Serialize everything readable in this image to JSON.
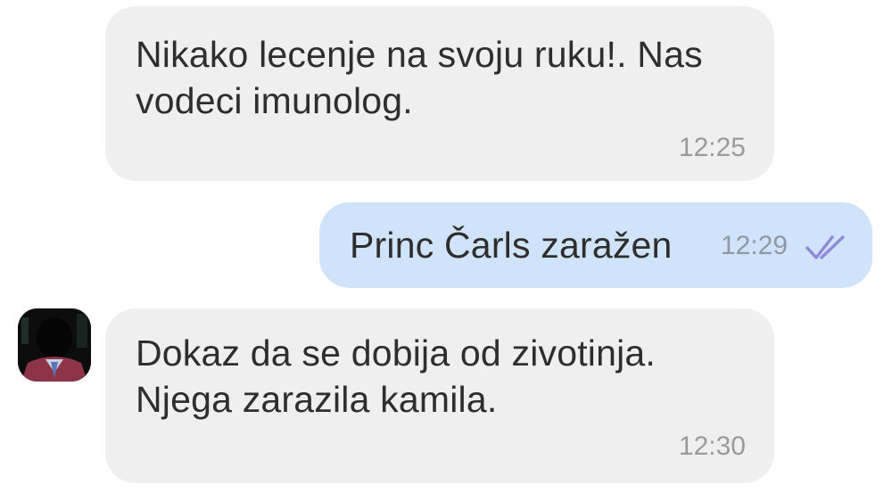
{
  "conversation": {
    "messages": [
      {
        "direction": "incoming",
        "lines": [
          "Nikako lecenje na svoju ruku!. Nas",
          "vodeci imunolog."
        ],
        "time": "12:25"
      },
      {
        "direction": "outgoing",
        "lines": [
          "Princ Čarls zaražen"
        ],
        "time": "12:29",
        "status_icon": "double-check-icon"
      },
      {
        "direction": "incoming",
        "lines": [
          "Dokaz da se dobija od zivotinja.",
          "Njega zarazila kamila."
        ],
        "time": "12:30",
        "sender_icon": "avatar"
      }
    ]
  },
  "colors": {
    "incoming_bubble": "#efefef",
    "outgoing_bubble": "#cfe4fb",
    "read_ticks": "#8f8ad8"
  }
}
